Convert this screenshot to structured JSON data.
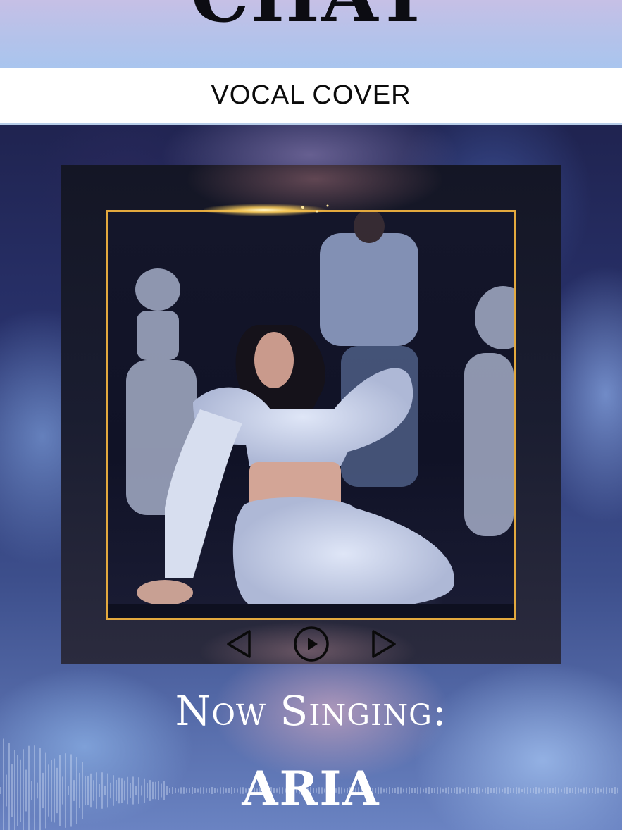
{
  "header": {
    "title": "CHAT",
    "subtitle": "VOCAL COVER"
  },
  "player": {
    "prev_icon": "triangle-left-icon",
    "play_icon": "play-circle-icon",
    "next_icon": "triangle-right-icon"
  },
  "now_playing": {
    "label": "Now Singing:",
    "singer": "ARIA"
  },
  "colors": {
    "frame_border": "#e3a93e",
    "header_band": "#b4c2ea",
    "text_light": "#ffffff"
  }
}
